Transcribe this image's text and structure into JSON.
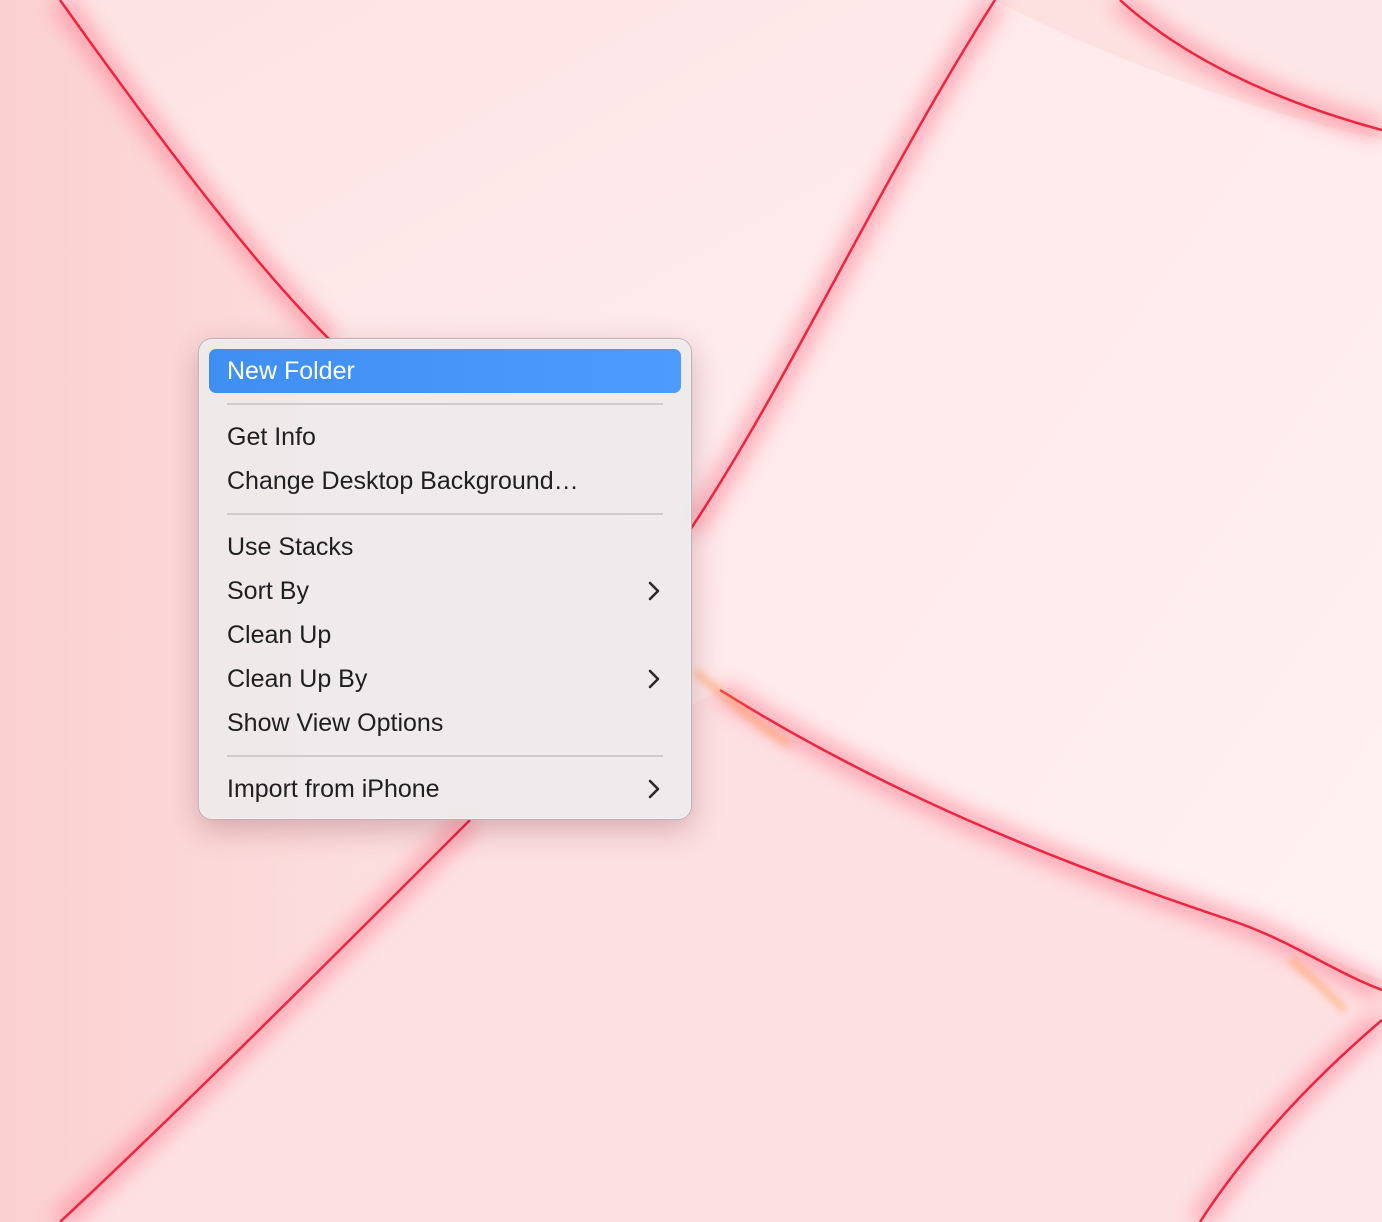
{
  "wallpaper": {
    "base_color": "#fbd6d6",
    "highlight_color": "#ffeff1",
    "edge_color": "#f2233f",
    "glow_color": "#ff7a8c",
    "orange_glint": "#ff9a4a"
  },
  "context_menu": {
    "accent_color": "#4a96fb",
    "groups": [
      [
        {
          "label": "New Folder",
          "highlighted": true,
          "submenu": false
        }
      ],
      [
        {
          "label": "Get Info",
          "highlighted": false,
          "submenu": false
        },
        {
          "label": "Change Desktop Background…",
          "highlighted": false,
          "submenu": false
        }
      ],
      [
        {
          "label": "Use Stacks",
          "highlighted": false,
          "submenu": false
        },
        {
          "label": "Sort By",
          "highlighted": false,
          "submenu": true
        },
        {
          "label": "Clean Up",
          "highlighted": false,
          "submenu": false
        },
        {
          "label": "Clean Up By",
          "highlighted": false,
          "submenu": true
        },
        {
          "label": "Show View Options",
          "highlighted": false,
          "submenu": false
        }
      ],
      [
        {
          "label": "Import from iPhone",
          "highlighted": false,
          "submenu": true
        }
      ]
    ]
  }
}
